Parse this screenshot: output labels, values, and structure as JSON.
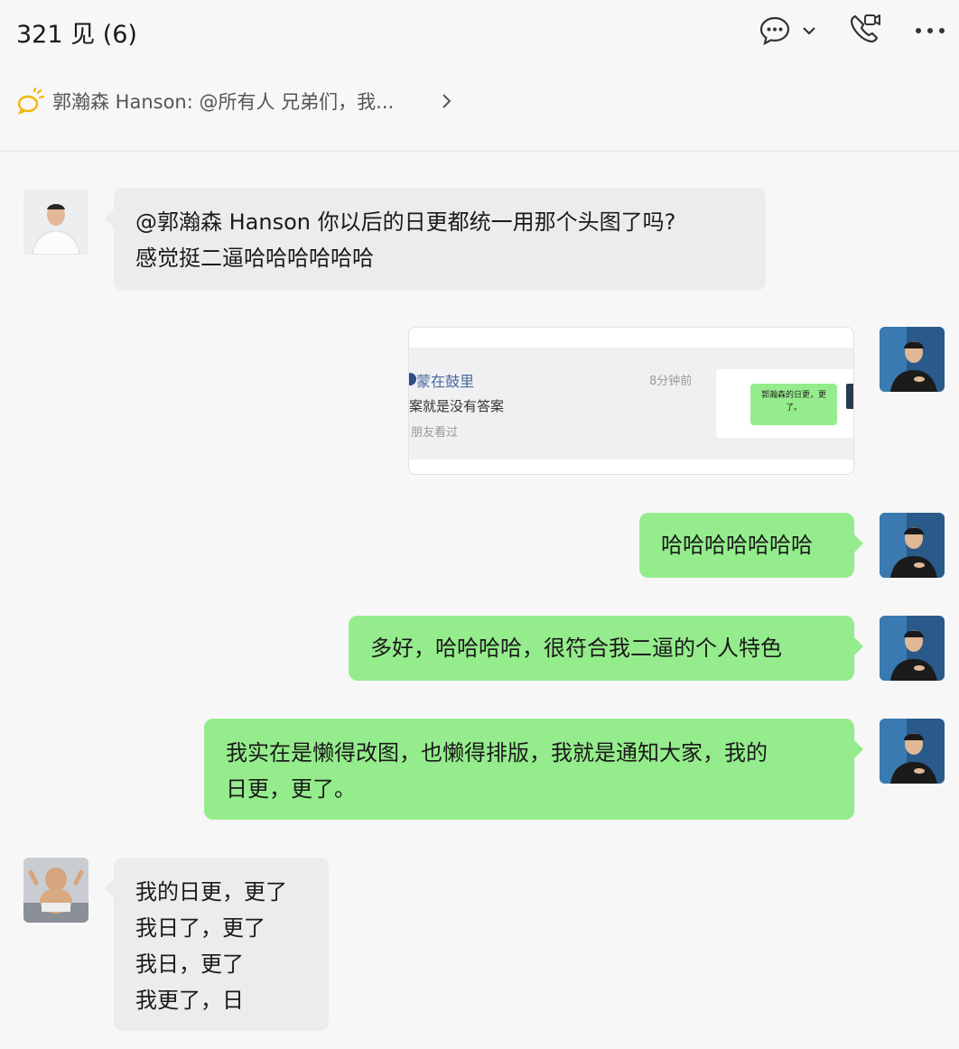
{
  "header": {
    "title": "321 见 (6)",
    "icons": [
      "chat-bubble-icon",
      "chevron-down-icon",
      "video-call-icon",
      "more-icon"
    ]
  },
  "pinned": {
    "text": "郭瀚森 Hanson: @所有人 兄弟们，我...",
    "icon": "announcement-icon"
  },
  "messages": [
    {
      "side": "in",
      "lines": [
        "@郭瀚森 Hanson 你以后的日更都统一用那个头图了吗?",
        "感觉挺二逼哈哈哈哈哈哈"
      ]
    },
    {
      "side": "out",
      "type": "image",
      "image": {
        "name": "蒙在鼓里",
        "time": "8分钟前",
        "text": "案就是没有答案",
        "sub": "朋友看过",
        "mini_text": "郭瀚森的日更，更了。"
      }
    },
    {
      "side": "out",
      "lines": [
        "哈哈哈哈哈哈哈"
      ]
    },
    {
      "side": "out",
      "lines": [
        "多好，哈哈哈哈，很符合我二逼的个人特色"
      ]
    },
    {
      "side": "out",
      "lines": [
        "我实在是懒得改图，也懒得排版，我就是通知大家，我的",
        "日更，更了。"
      ]
    },
    {
      "side": "in",
      "lines": [
        "我的日更，更了",
        "我日了，更了",
        "我日，更了",
        "我更了，日"
      ]
    }
  ],
  "colors": {
    "outgoing": "#95ec8c",
    "incoming": "#ececec",
    "background": "#f7f7f7"
  }
}
